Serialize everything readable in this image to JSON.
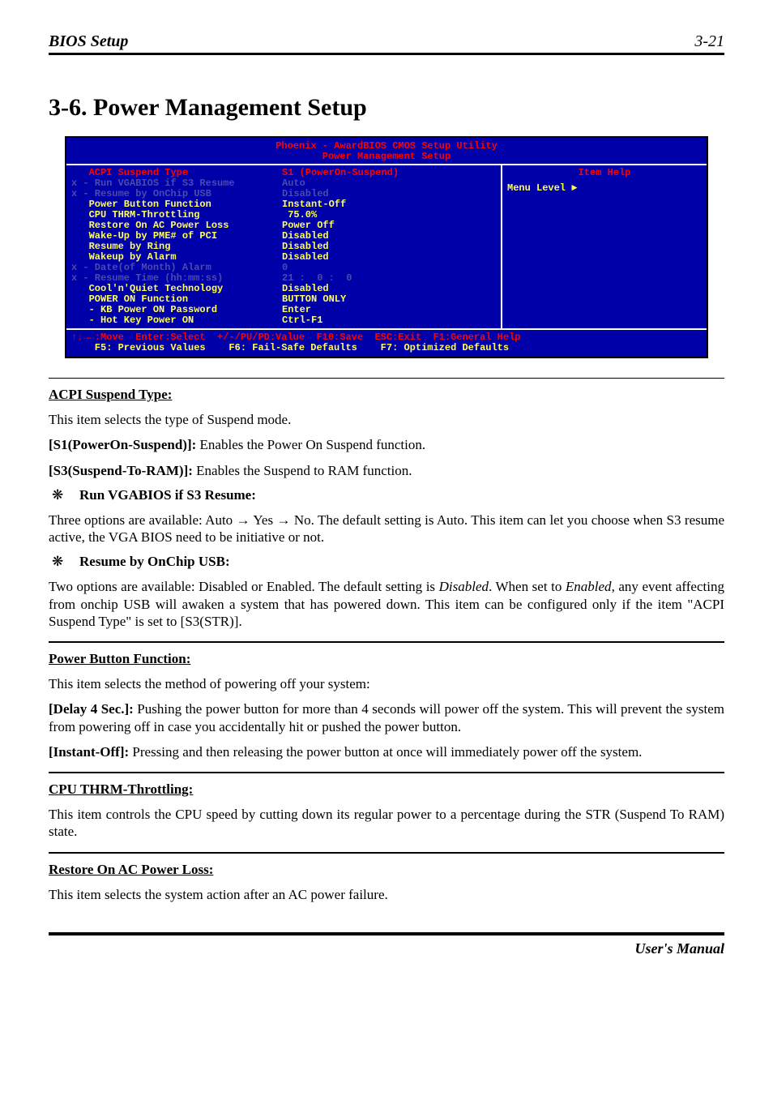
{
  "header": {
    "left": "BIOS Setup",
    "right": "3-21"
  },
  "section_title": "3-6.  Power Management Setup",
  "bios": {
    "title1": "Phoenix - AwardBIOS CMOS Setup Utility",
    "title2": "Power Management Setup",
    "item_help": "Item Help",
    "menu_level": "Menu Level    ►",
    "rows": [
      {
        "cls": "red",
        "label": "   ACPI Suspend Type",
        "value": "S1 (PowerOn-Suspend)"
      },
      {
        "cls": "dim",
        "label": "x - Run VGABIOS if S3 Resume",
        "value": "Auto"
      },
      {
        "cls": "dim",
        "label": "x - Resume by OnChip USB",
        "value": "Disabled"
      },
      {
        "cls": "yellow",
        "label": "   Power Button Function",
        "value": "Instant-Off"
      },
      {
        "cls": "yellow",
        "label": "   CPU THRM-Throttling",
        "value": " 75.0%"
      },
      {
        "cls": "yellow",
        "label": "   Restore On AC Power Loss",
        "value": "Power Off"
      },
      {
        "cls": "yellow",
        "label": "   Wake-Up by PME# of PCI",
        "value": "Disabled"
      },
      {
        "cls": "yellow",
        "label": "   Resume by Ring",
        "value": "Disabled"
      },
      {
        "cls": "yellow",
        "label": "   Wakeup by Alarm",
        "value": "Disabled"
      },
      {
        "cls": "dim",
        "label": "x - Date(of Month) Alarm",
        "value": "0"
      },
      {
        "cls": "dim",
        "label": "x - Resume Time (hh:mm:ss)",
        "value": "21 :  0 :  0"
      },
      {
        "cls": "yellow",
        "label": "   Cool'n'Quiet Technology",
        "value": "Disabled"
      },
      {
        "cls": "yellow",
        "label": "   POWER ON Function",
        "value": "BUTTON ONLY"
      },
      {
        "cls": "yellow",
        "label": "   - KB Power ON Password",
        "value": "Enter"
      },
      {
        "cls": "yellow",
        "label": "   - Hot Key Power ON",
        "value": "Ctrl-F1"
      }
    ],
    "footer_line1": "↑↓→←:Move  Enter:Select  +/-/PU/PD:Value  F10:Save  ESC:Exit  F1:General Help",
    "footer_line2": "    F5: Previous Values    F6: Fail-Safe Defaults    F7: Optimized Defaults"
  },
  "content": {
    "acpi_heading": "ACPI Suspend Type:",
    "p1": "This item selects the type of Suspend mode.",
    "p2_bold": "[S1(PowerOn-Suspend)]:",
    "p2_rest": " Enables the Power On Suspend function.",
    "p3_bold": "[S3(Suspend-To-RAM)]:",
    "p3_rest": " Enables the Suspend to RAM function.",
    "bullet1_icon": "❋",
    "bullet1_text": "Run VGABIOS if S3 Resume:",
    "p4": "Three options are available: Auto → Yes → No. The default setting is Auto. This item can let you choose when S3 resume active, the VGA BIOS need to be initiative or not.",
    "bullet2_icon": "❋",
    "bullet2_text": "Resume by OnChip USB:",
    "p5a": "Two options are available: Disabled or Enabled. The default setting is ",
    "p5_disabled": "Disabled",
    "p5b": ". When set to ",
    "p5_enabled": "Enabled",
    "p5c": ", any event affecting from onchip USB will awaken a system that has powered down. This item can be configured only if the item \"ACPI Suspend Type\" is set to [S3(STR)].",
    "pbf_heading": "Power Button Function:",
    "p6": "This item selects the method of powering off your system:",
    "p7_bold": "[Delay 4 Sec.]:",
    "p7_rest": " Pushing the power button for more than 4 seconds will power off the system. This will prevent the system from powering off in case you accidentally hit or pushed the power button.",
    "p8_bold": "[Instant-Off]:",
    "p8_rest": " Pressing and then releasing the power button at once will immediately power off the system.",
    "cpu_heading": "CPU THRM-Throttling:",
    "p9": "This item controls the CPU speed by cutting down its regular power to a percentage during the STR (Suspend To RAM) state.",
    "restore_heading": "Restore On AC Power Loss:",
    "p10": "This item selects the system action after an AC power failure."
  },
  "footer": {
    "text": "User's Manual"
  }
}
